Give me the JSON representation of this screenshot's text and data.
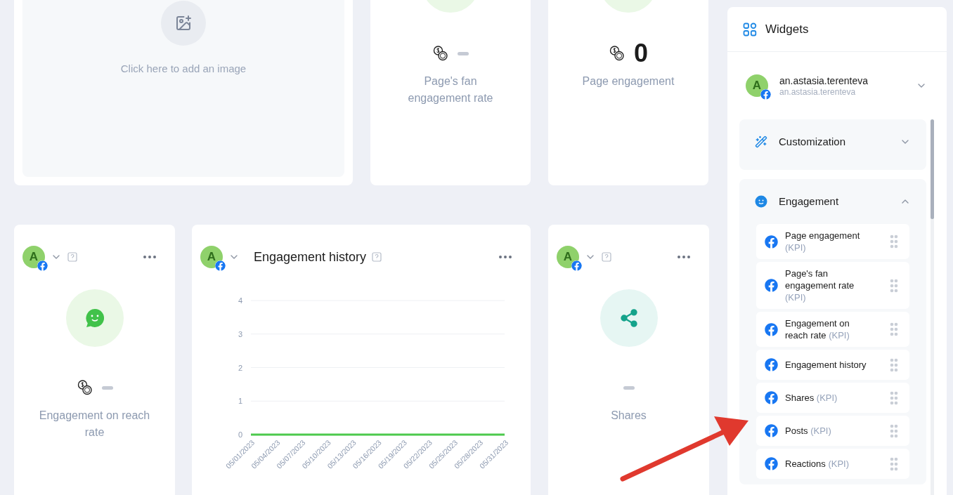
{
  "top_cards": [
    {
      "kind": "image",
      "hint": "Click here to add an image"
    },
    {
      "kind": "kpi",
      "label": "Page's fan engagement rate"
    },
    {
      "kind": "kpi",
      "value": "0",
      "label": "Page engagement"
    }
  ],
  "bottom_cards": [
    {
      "kind": "kpi",
      "avatar": "A",
      "label": "Engagement on reach rate"
    },
    {
      "kind": "chart",
      "avatar": "A",
      "title": "Engagement history",
      "chart_data": {
        "type": "line",
        "categories": [
          "05/01/2023",
          "05/04/2023",
          "05/07/2023",
          "05/10/2023",
          "05/13/2023",
          "05/16/2023",
          "05/19/2023",
          "05/22/2023",
          "05/25/2023",
          "05/28/2023",
          "05/31/2023"
        ],
        "ylim": [
          0,
          4
        ],
        "yticks": [
          0,
          1,
          2,
          3,
          4
        ],
        "grid": true,
        "series": [
          {
            "color": "#4cc94c",
            "values": [
              0,
              0,
              0,
              0,
              0,
              0,
              0,
              0,
              0,
              0,
              0
            ]
          }
        ]
      }
    },
    {
      "kind": "kpi",
      "avatar": "A",
      "label": "Shares"
    }
  ],
  "sidebar": {
    "title": "Widgets",
    "account": {
      "avatar": "A",
      "name": "an.astasia.terenteva",
      "handle": "an.astasia.terenteva"
    },
    "sections": [
      {
        "title": "Customization",
        "expanded": false
      },
      {
        "title": "Engagement",
        "expanded": true,
        "items": [
          {
            "name": "Page engagement",
            "tag": "(KPI)"
          },
          {
            "name": "Page's fan engagement rate",
            "tag": "(KPI)"
          },
          {
            "name": "Engagement on reach rate",
            "tag": "(KPI)"
          },
          {
            "name": "Engagement history"
          },
          {
            "name": "Shares",
            "tag": "(KPI)"
          },
          {
            "name": "Posts",
            "tag": "(KPI)"
          },
          {
            "name": "Reactions",
            "tag": "(KPI)"
          }
        ]
      }
    ]
  }
}
